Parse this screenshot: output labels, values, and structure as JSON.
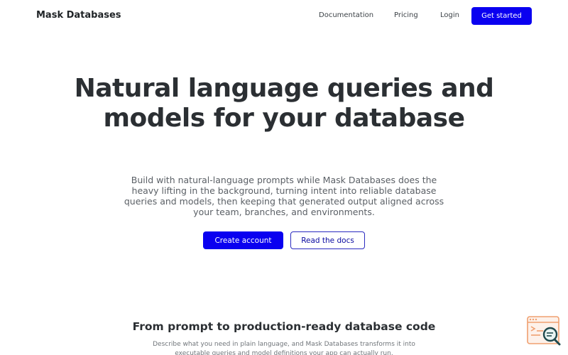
{
  "nav": {
    "brand": "Mask Databases",
    "links": [
      "Documentation",
      "Pricing",
      "Login"
    ],
    "cta": "Get started"
  },
  "hero": {
    "title": "Natural language queries and models for your database",
    "subtitle": "Build with natural-language prompts while Mask Databases does the heavy lifting in the background, turning intent into reliable database queries and models, then keeping that generated output aligned across your team, branches, and environments.",
    "primary_button": "Create account",
    "secondary_button": "Read the docs"
  },
  "section": {
    "title": "From prompt to production-ready database code",
    "subtitle": "Describe what you need in plain language, and Mask Databases transforms it into executable queries and model definitions your app can actually run."
  },
  "widget": {
    "icon": "code-search-icon",
    "colors": {
      "frame": "#f0a070",
      "magnifier": "#1f4a4e"
    }
  },
  "colors": {
    "accent": "#0a00f0",
    "text": "#2b2f33",
    "muted": "#5b6066"
  }
}
